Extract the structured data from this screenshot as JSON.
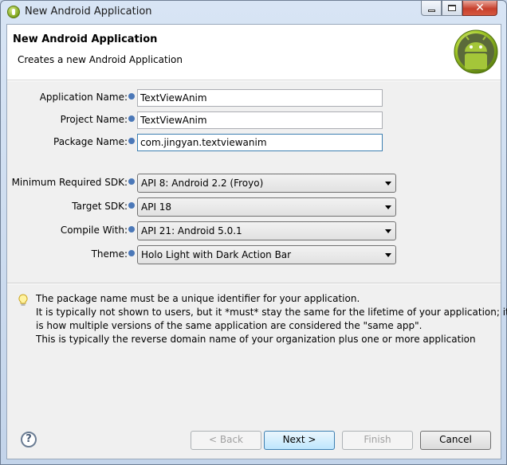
{
  "window": {
    "title": "New Android Application",
    "close_glyph": "✕"
  },
  "header": {
    "title": "New Android Application",
    "subtitle": "Creates a new Android Application"
  },
  "fields": {
    "application_name": {
      "label": "Application Name:",
      "value": "TextViewAnim"
    },
    "project_name": {
      "label": "Project Name:",
      "value": "TextViewAnim"
    },
    "package_name": {
      "label": "Package Name:",
      "value": "com.jingyan.textviewanim"
    }
  },
  "selects": {
    "min_sdk": {
      "label": "Minimum Required SDK:",
      "value": "API 8: Android 2.2 (Froyo)"
    },
    "target_sdk": {
      "label": "Target SDK:",
      "value": "API 18"
    },
    "compile_with": {
      "label": "Compile With:",
      "value": "API 21: Android 5.0.1"
    },
    "theme": {
      "label": "Theme:",
      "value": "Holo Light with Dark Action Bar"
    }
  },
  "hint": {
    "lines": [
      "The package name must be a unique identifier for your application.",
      "It is typically not shown to users, but it *must* stay the same for the lifetime of your application; it",
      "is how multiple versions of the same application are considered the \"same app\".",
      "This is typically the reverse domain name of your organization plus one or more application"
    ]
  },
  "footer": {
    "help_glyph": "?",
    "back_label": "< Back",
    "next_label": "Next >",
    "finish_label": "Finish",
    "cancel_label": "Cancel"
  },
  "icons": {
    "app": "android-adt-icon",
    "logo": "android-robot-logo",
    "info": "info-icon",
    "hint": "lightbulb-icon",
    "help": "help-icon"
  },
  "colors": {
    "accent": "#3c7fb1",
    "android_green": "#9fc51f",
    "close_button": "#c7402d"
  }
}
